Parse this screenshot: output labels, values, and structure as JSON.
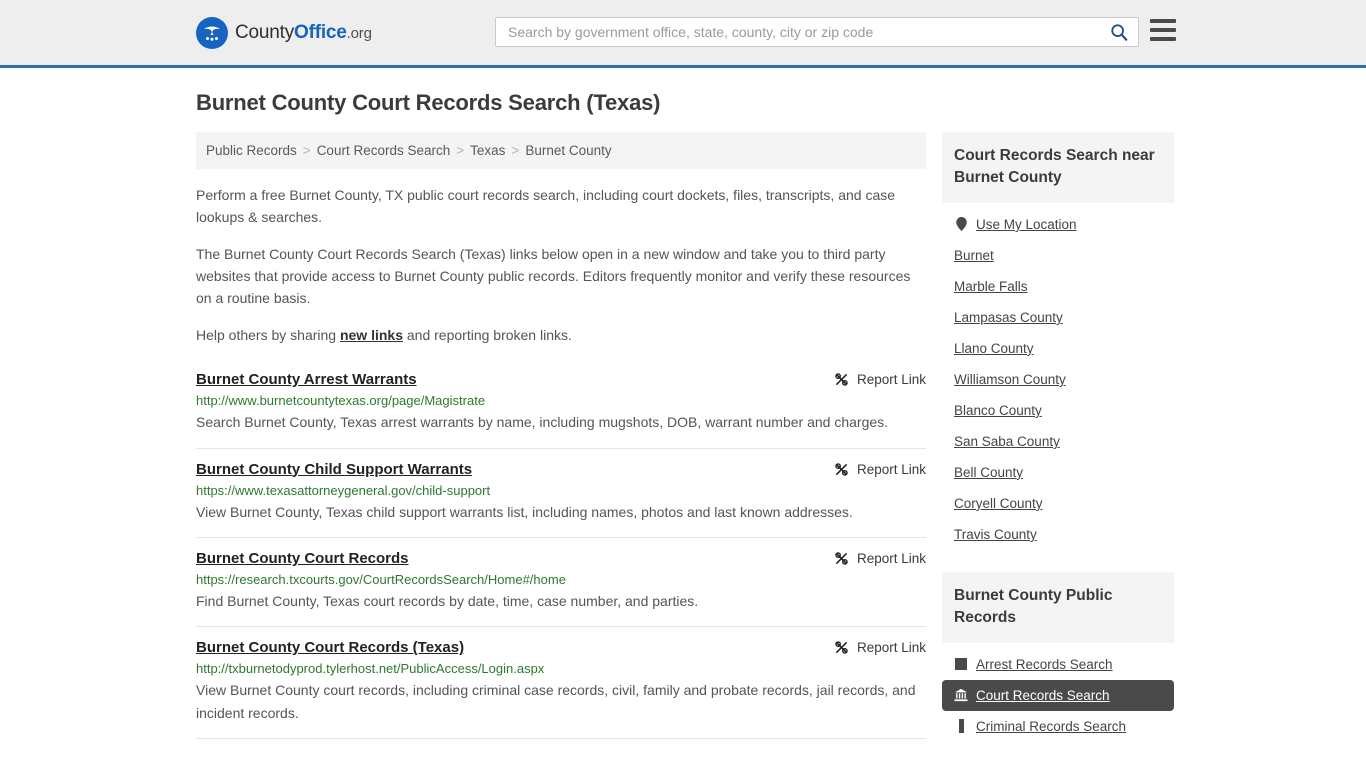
{
  "header": {
    "brand": {
      "part1": "County",
      "part2": "Office",
      "part3": ".org",
      "logo_icon": "eagle-shield-icon"
    },
    "search": {
      "placeholder": "Search by government office, state, county, city or zip code",
      "value": ""
    },
    "menu_icon": "hamburger-menu-icon",
    "search_icon": "search-icon",
    "accent_color": "#2b6cab"
  },
  "page": {
    "title": "Burnet County Court Records Search (Texas)",
    "breadcrumb": [
      "Public Records",
      "Court Records Search",
      "Texas",
      "Burnet County"
    ],
    "breadcrumb_separator": ">",
    "intro": [
      "Perform a free Burnet County, TX public court records search, including court dockets, files, transcripts, and case lookups & searches.",
      "The Burnet County Court Records Search (Texas) links below open in a new window and take you to third party websites that provide access to Burnet County public records. Editors frequently monitor and verify these resources on a routine basis."
    ],
    "help_prefix": "Help others by sharing ",
    "help_link": "new links",
    "help_suffix": " and reporting broken links."
  },
  "results": {
    "report_label": "Report Link",
    "report_icon": "broken-link-icon",
    "items": [
      {
        "title": "Burnet County Arrest Warrants",
        "url": "http://www.burnetcountytexas.org/page/Magistrate",
        "description": "Search Burnet County, Texas arrest warrants by name, including mugshots, DOB, warrant number and charges."
      },
      {
        "title": "Burnet County Child Support Warrants",
        "url": "https://www.texasattorneygeneral.gov/child-support",
        "description": "View Burnet County, Texas child support warrants list, including names, photos and last known addresses."
      },
      {
        "title": "Burnet County Court Records",
        "url": "https://research.txcourts.gov/CourtRecordsSearch/Home#/home",
        "description": "Find Burnet County, Texas court records by date, time, case number, and parties."
      },
      {
        "title": "Burnet County Court Records (Texas)",
        "url": "http://txburnetodyprod.tylerhost.net/PublicAccess/Login.aspx",
        "description": "View Burnet County court records, including criminal case records, civil, family and probate records, jail records, and incident records."
      }
    ]
  },
  "sidebar": {
    "nearby": {
      "heading": "Court Records Search near Burnet County",
      "items": [
        {
          "label": "Use My Location",
          "icon": "map-pin-icon"
        },
        {
          "label": "Burnet",
          "icon": ""
        },
        {
          "label": "Marble Falls",
          "icon": ""
        },
        {
          "label": "Lampasas County",
          "icon": ""
        },
        {
          "label": "Llano County",
          "icon": ""
        },
        {
          "label": "Williamson County",
          "icon": ""
        },
        {
          "label": "Blanco County",
          "icon": ""
        },
        {
          "label": "San Saba County",
          "icon": ""
        },
        {
          "label": "Bell County",
          "icon": ""
        },
        {
          "label": "Coryell County",
          "icon": ""
        },
        {
          "label": "Travis County",
          "icon": ""
        }
      ]
    },
    "public_records": {
      "heading": "Burnet County Public Records",
      "items": [
        {
          "label": "Arrest Records Search",
          "icon": "square-icon",
          "active": false
        },
        {
          "label": "Court Records Search",
          "icon": "courthouse-icon",
          "active": true
        },
        {
          "label": "Criminal Records Search",
          "icon": "bar-icon",
          "active": false
        }
      ]
    },
    "active_color": "#4a4a4a"
  }
}
